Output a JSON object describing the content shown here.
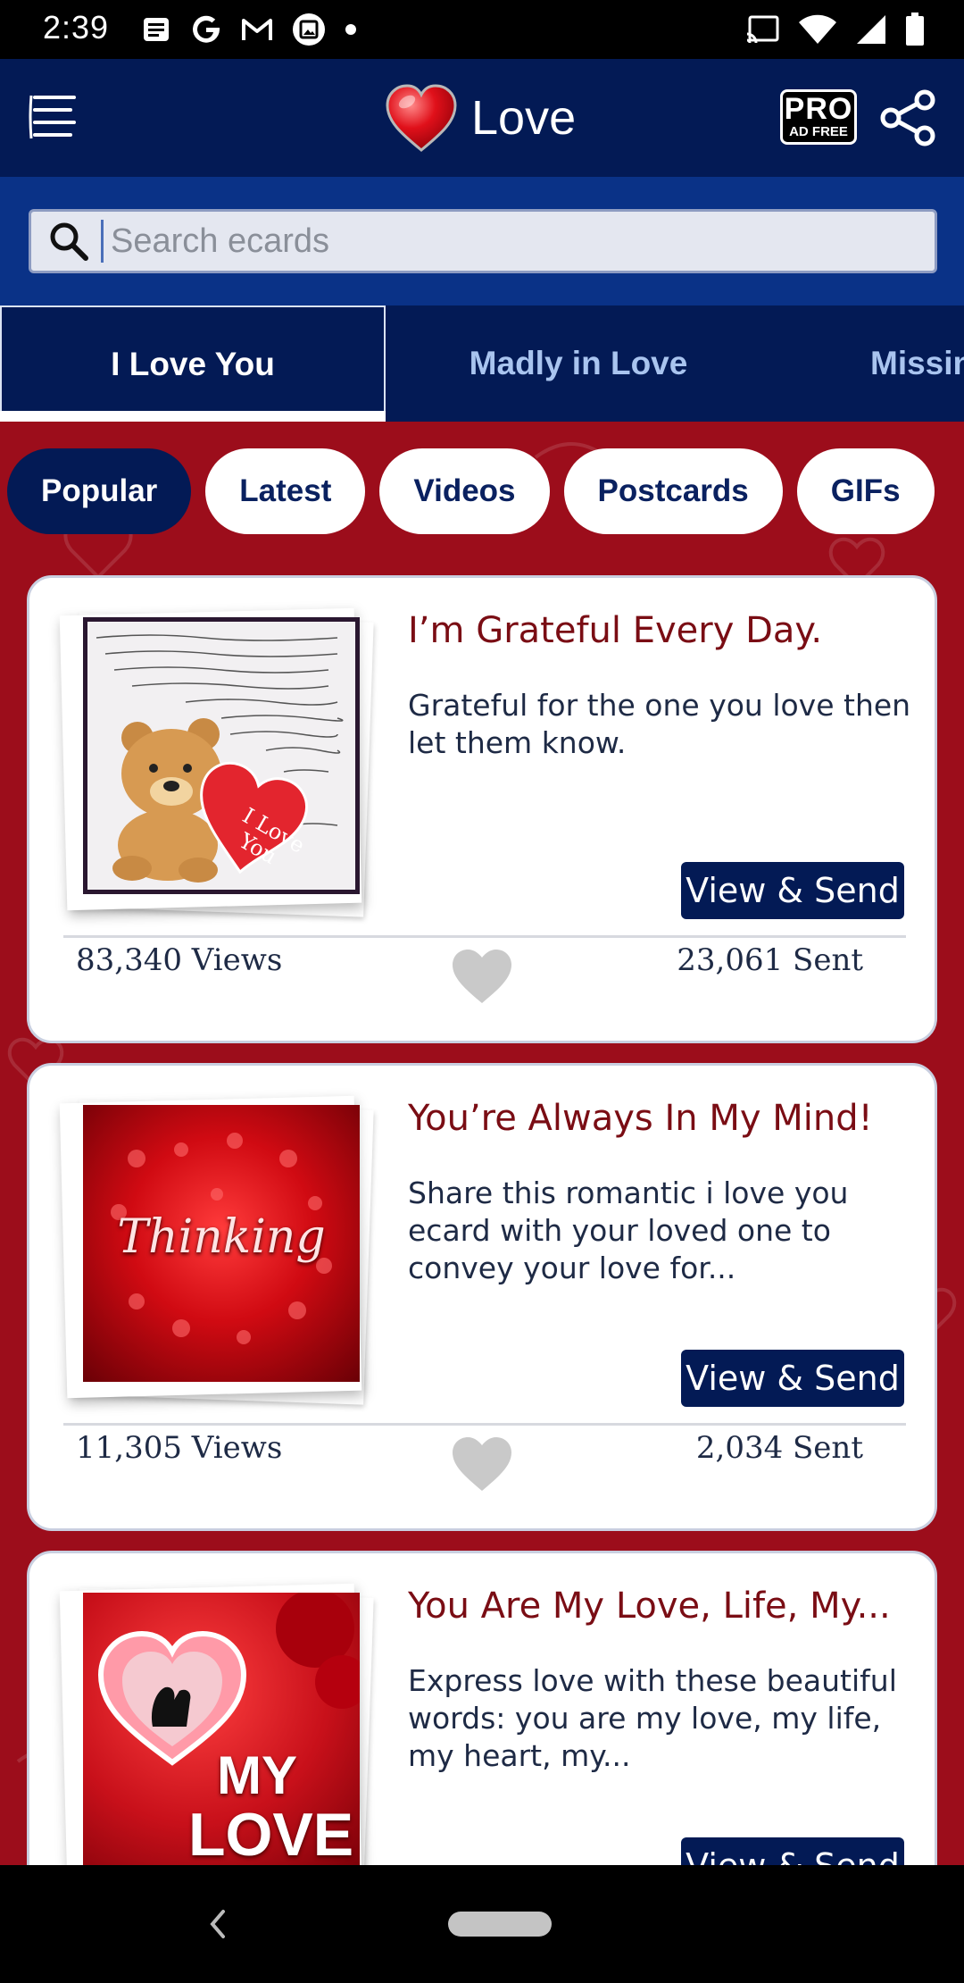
{
  "status_bar": {
    "time": "2:39",
    "left_icons": [
      "notes-icon",
      "google-icon",
      "gmail-icon",
      "photo-icon",
      "dot-icon"
    ],
    "right_icons": [
      "cast-icon",
      "wifi-icon",
      "signal-icon",
      "battery-icon"
    ]
  },
  "app_bar": {
    "title": "Love",
    "pro_label": "PRO",
    "ad_free_label": "AD FREE"
  },
  "search": {
    "placeholder": "Search ecards"
  },
  "tabs": [
    {
      "label": "I Love You",
      "active": true
    },
    {
      "label": "Madly in Love",
      "active": false
    },
    {
      "label": "Missin",
      "active": false
    }
  ],
  "filters": [
    {
      "label": "Popular",
      "active": true
    },
    {
      "label": "Latest",
      "active": false
    },
    {
      "label": "Videos",
      "active": false
    },
    {
      "label": "Postcards",
      "active": false
    },
    {
      "label": "GIFs",
      "active": false
    }
  ],
  "cards": [
    {
      "title": "I’m Grateful Every Day.",
      "description": "Grateful for the one you love then let them know.",
      "button": "View & Send",
      "views": "83,340 Views",
      "sent": "23,061 Sent",
      "thumb_icon": "teddy-bear-heart-icon"
    },
    {
      "title": "You’re Always In My Mind!",
      "description": "Share this romantic i love you ecard with your loved one to convey your love for...",
      "button": "View & Send",
      "views": "11,305 Views",
      "sent": "2,034 Sent",
      "thumb_text": "Thinking"
    },
    {
      "title": "You Are My Love, Life, My...",
      "description": "Express love with these beautiful words: you are my love, my life, my heart, my...",
      "button": "View & Send",
      "thumb_text_1": "MY",
      "thumb_text_2": "LOVE"
    }
  ],
  "colors": {
    "navy": "#031a55",
    "search_band": "#0a3287",
    "background_red": "#9c0d1b",
    "title_red": "#7a0d14",
    "tab_inactive": "#a9c4ef"
  }
}
